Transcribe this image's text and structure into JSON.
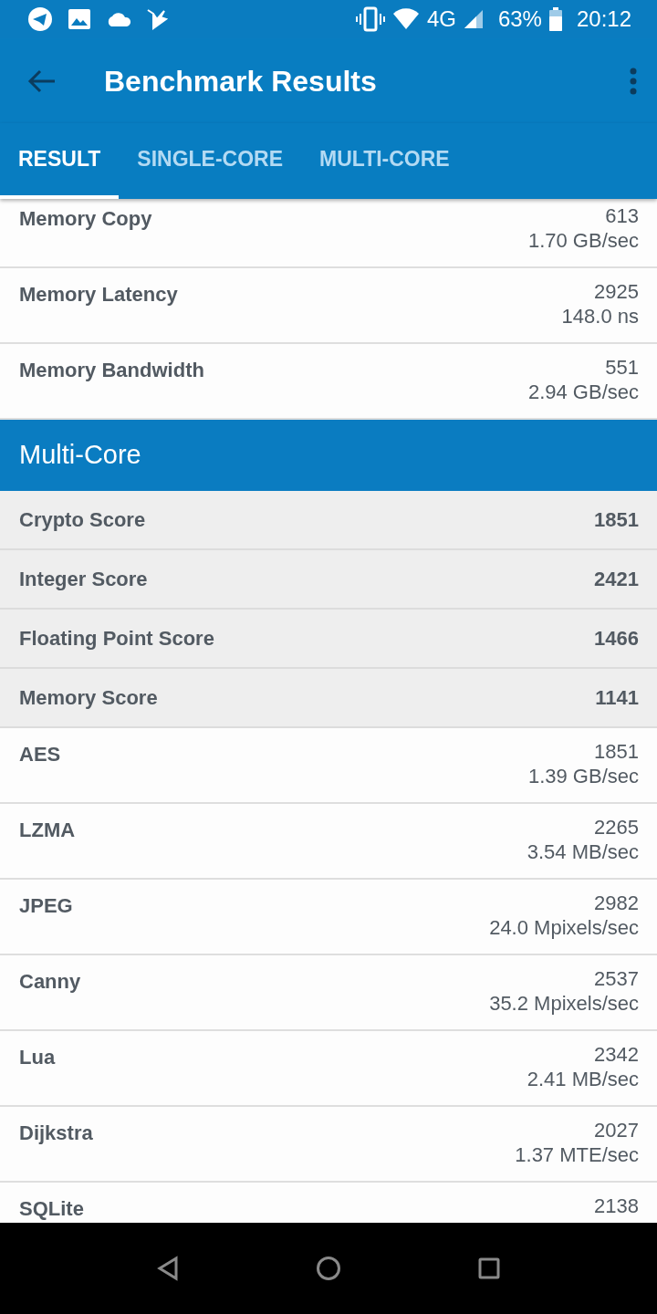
{
  "status_bar": {
    "network": "4G",
    "battery": "63%",
    "time": "20:12"
  },
  "app_bar": {
    "title": "Benchmark Results"
  },
  "tabs": [
    {
      "label": "RESULT",
      "selected": true
    },
    {
      "label": "SINGLE-CORE",
      "selected": false
    },
    {
      "label": "MULTI-CORE",
      "selected": false
    }
  ],
  "items": [
    {
      "kind": "result",
      "name": "Memory Copy",
      "score": "613",
      "detail": "1.70 GB/sec"
    },
    {
      "kind": "result",
      "name": "Memory Latency",
      "score": "2925",
      "detail": "148.0 ns"
    },
    {
      "kind": "result",
      "name": "Memory Bandwidth",
      "score": "551",
      "detail": "2.94 GB/sec"
    },
    {
      "kind": "header",
      "name": "Multi-Core"
    },
    {
      "kind": "score",
      "name": "Crypto Score",
      "score": "1851"
    },
    {
      "kind": "score",
      "name": "Integer Score",
      "score": "2421"
    },
    {
      "kind": "score",
      "name": "Floating Point Score",
      "score": "1466"
    },
    {
      "kind": "score",
      "name": "Memory Score",
      "score": "1141"
    },
    {
      "kind": "result",
      "name": "AES",
      "score": "1851",
      "detail": "1.39 GB/sec"
    },
    {
      "kind": "result",
      "name": "LZMA",
      "score": "2265",
      "detail": "3.54 MB/sec"
    },
    {
      "kind": "result",
      "name": "JPEG",
      "score": "2982",
      "detail": "24.0 Mpixels/sec"
    },
    {
      "kind": "result",
      "name": "Canny",
      "score": "2537",
      "detail": "35.2 Mpixels/sec"
    },
    {
      "kind": "result",
      "name": "Lua",
      "score": "2342",
      "detail": "2.41 MB/sec"
    },
    {
      "kind": "result",
      "name": "Dijkstra",
      "score": "2027",
      "detail": "1.37 MTE/sec"
    },
    {
      "kind": "result",
      "name": "SQLite",
      "score": "2138"
    }
  ]
}
